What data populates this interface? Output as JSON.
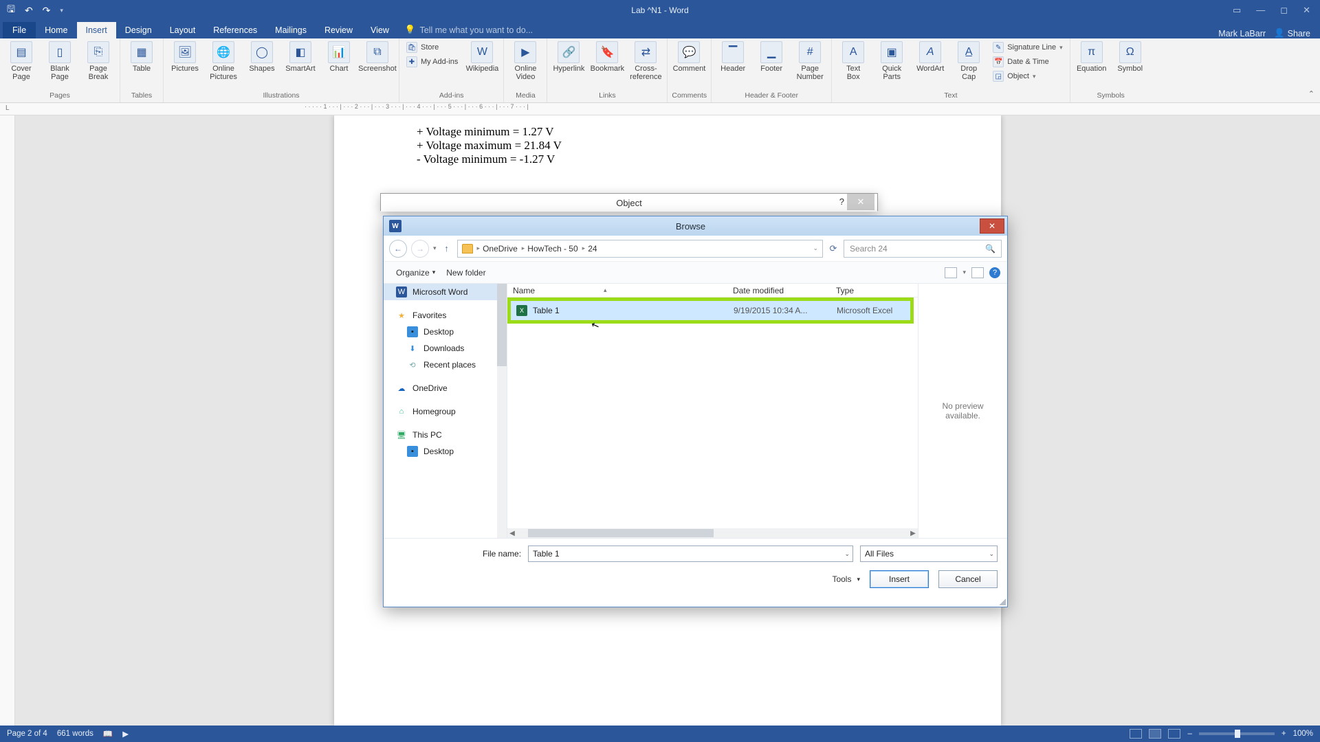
{
  "titlebar": {
    "title": "Lab ^N1 - Word"
  },
  "account": {
    "user": "Mark LaBarr",
    "share": "Share"
  },
  "tabs": {
    "file": "File",
    "items": [
      "Home",
      "Insert",
      "Design",
      "Layout",
      "References",
      "Mailings",
      "Review",
      "View"
    ],
    "active_index": 1,
    "tellme_placeholder": "Tell me what you want to do..."
  },
  "ribbon": {
    "groups": {
      "pages": {
        "name": "Pages",
        "cover": "Cover\nPage",
        "blank": "Blank\nPage",
        "break": "Page\nBreak"
      },
      "tables": {
        "name": "Tables",
        "table": "Table"
      },
      "illus": {
        "name": "Illustrations",
        "pics": "Pictures",
        "online": "Online\nPictures",
        "shapes": "Shapes",
        "smart": "SmartArt",
        "chart": "Chart",
        "screen": "Screenshot"
      },
      "addins": {
        "name": "Add-ins",
        "store": "Store",
        "my": "My Add-ins",
        "wiki": "Wikipedia"
      },
      "media": {
        "name": "Media",
        "video": "Online\nVideo"
      },
      "links": {
        "name": "Links",
        "hyper": "Hyperlink",
        "book": "Bookmark",
        "cross": "Cross-\nreference"
      },
      "comments": {
        "name": "Comments",
        "comment": "Comment"
      },
      "hf": {
        "name": "Header & Footer",
        "header": "Header",
        "footer": "Footer",
        "page": "Page\nNumber"
      },
      "text": {
        "name": "Text",
        "tbox": "Text\nBox",
        "qparts": "Quick\nParts",
        "wart": "WordArt",
        "drop": "Drop\nCap",
        "sig": "Signature Line",
        "date": "Date & Time",
        "obj": "Object"
      },
      "symbols": {
        "name": "Symbols",
        "eq": "Equation",
        "sym": "Symbol"
      }
    }
  },
  "ruler": {
    "marks": "· · · · · 1 · · · | · · · 2 · · · | · · · 3 · · · | · · · 4 · · · | · · · 5 · · · | · · · 6 · · · | · · · 7 · · · |"
  },
  "doc": {
    "line1": "+ Voltage minimum = 1.27 V",
    "line2": "+ Voltage maximum = 21.84 V",
    "line3": "- Voltage minimum = -1.27 V"
  },
  "object_dialog": {
    "title": "Object"
  },
  "browse": {
    "title": "Browse",
    "crumbs": [
      "OneDrive",
      "HowTech - 50",
      "24"
    ],
    "search_placeholder": "Search 24",
    "organize": "Organize",
    "newfolder": "New folder",
    "columns": {
      "name": "Name",
      "date": "Date modified",
      "type": "Type"
    },
    "file": {
      "name": "Table 1",
      "date": "9/19/2015 10:34 A...",
      "type": "Microsoft Excel"
    },
    "preview": "No preview available.",
    "nav": {
      "word": "Microsoft Word",
      "fav": "Favorites",
      "desktop": "Desktop",
      "downloads": "Downloads",
      "recent": "Recent places",
      "onedrive": "OneDrive",
      "homegroup": "Homegroup",
      "thispc": "This PC",
      "desktop2": "Desktop"
    },
    "footer": {
      "label": "File name:",
      "value": "Table 1",
      "filter": "All Files",
      "tools": "Tools",
      "insert": "Insert",
      "cancel": "Cancel"
    }
  },
  "status": {
    "page": "Page 2 of 4",
    "words": "661 words",
    "zoom": "100%"
  }
}
